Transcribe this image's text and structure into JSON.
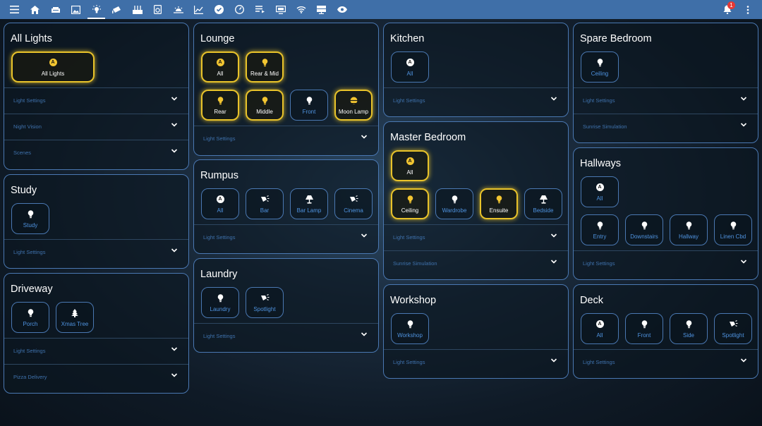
{
  "topbar": {
    "icons": [
      "menu-icon",
      "home-icon",
      "sofa-icon",
      "image-icon",
      "lightbulb-icon",
      "cctv-icon",
      "router-icon",
      "washer-icon",
      "sunrise-icon",
      "chart-icon",
      "check-circle-icon",
      "gauge-icon",
      "playlist-icon",
      "monitor-icon",
      "wifi-icon",
      "server-icon",
      "eye-icon"
    ],
    "notification_count": "1"
  },
  "cards": {
    "all_lights": {
      "title": "All Lights",
      "tiles": [
        {
          "label": "All Lights",
          "icon": "auto",
          "on": true
        }
      ],
      "rows": [
        "Light Settings",
        "Night Vision",
        "Scenes"
      ]
    },
    "study": {
      "title": "Study",
      "tiles": [
        {
          "label": "Study",
          "icon": "bulb",
          "on": false
        }
      ],
      "rows": [
        "Light Settings"
      ]
    },
    "driveway": {
      "title": "Driveway",
      "tiles": [
        {
          "label": "Porch",
          "icon": "bulb",
          "on": false
        },
        {
          "label": "Xmas Tree",
          "icon": "tree",
          "on": false
        }
      ],
      "rows": [
        "Light Settings",
        "Pizza Delivery"
      ]
    },
    "lounge": {
      "title": "Lounge",
      "tiles": [
        {
          "label": "All",
          "icon": "auto",
          "on": true
        },
        {
          "label": "Rear & Mid",
          "icon": "bulb",
          "on": true
        },
        {
          "label": "Rear",
          "icon": "bulb",
          "on": true
        },
        {
          "label": "Middle",
          "icon": "bulb",
          "on": true
        },
        {
          "label": "Front",
          "icon": "bulb",
          "on": false
        },
        {
          "label": "Moon Lamp",
          "icon": "moon",
          "on": true
        }
      ],
      "rows": [
        "Light Settings"
      ]
    },
    "rumpus": {
      "title": "Rumpus",
      "tiles": [
        {
          "label": "All",
          "icon": "auto",
          "on": false
        },
        {
          "label": "Bar",
          "icon": "spot",
          "on": false
        },
        {
          "label": "Bar Lamp",
          "icon": "lamp",
          "on": false
        },
        {
          "label": "Cinema",
          "icon": "spot",
          "on": false
        }
      ],
      "rows": [
        "Light Settings"
      ]
    },
    "laundry": {
      "title": "Laundry",
      "tiles": [
        {
          "label": "Laundry",
          "icon": "bulb",
          "on": false
        },
        {
          "label": "Spotlight",
          "icon": "spot",
          "on": false
        }
      ],
      "rows": [
        "Light Settings"
      ]
    },
    "kitchen": {
      "title": "Kitchen",
      "tiles": [
        {
          "label": "All",
          "icon": "auto",
          "on": false
        }
      ],
      "rows": [
        "Light Settings"
      ]
    },
    "master_bedroom": {
      "title": "Master Bedroom",
      "tiles": [
        {
          "label": "All",
          "icon": "auto",
          "on": true
        },
        {
          "label": "Ceiling",
          "icon": "bulb",
          "on": true
        },
        {
          "label": "Wardrobe",
          "icon": "bulb",
          "on": false
        },
        {
          "label": "Ensuite",
          "icon": "bulb",
          "on": true
        },
        {
          "label": "Bedside",
          "icon": "lamp",
          "on": false
        }
      ],
      "rows": [
        "Light Settings",
        "Sunrise Simulation"
      ]
    },
    "workshop": {
      "title": "Workshop",
      "tiles": [
        {
          "label": "Workshop",
          "icon": "bulb",
          "on": false
        }
      ],
      "rows": [
        "Light Settings"
      ]
    },
    "spare_bedroom": {
      "title": "Spare Bedroom",
      "tiles": [
        {
          "label": "Ceiling",
          "icon": "bulb",
          "on": false
        }
      ],
      "rows": [
        "Light Settings",
        "Sunrise Simulation"
      ]
    },
    "hallways": {
      "title": "Hallways",
      "tiles": [
        {
          "label": "All",
          "icon": "auto",
          "on": false
        },
        {
          "label": "Entry",
          "icon": "bulb",
          "on": false
        },
        {
          "label": "Downstairs",
          "icon": "bulb",
          "on": false
        },
        {
          "label": "Hallway",
          "icon": "bulb",
          "on": false
        },
        {
          "label": "Linen Cbd",
          "icon": "bulb",
          "on": false
        }
      ],
      "rows": [
        "Light Settings"
      ]
    },
    "deck": {
      "title": "Deck",
      "tiles": [
        {
          "label": "All",
          "icon": "auto",
          "on": false
        },
        {
          "label": "Front",
          "icon": "bulb",
          "on": false
        },
        {
          "label": "Side",
          "icon": "bulb",
          "on": false
        },
        {
          "label": "Spotlight",
          "icon": "spot",
          "on": false
        }
      ],
      "rows": [
        "Light Settings"
      ]
    }
  },
  "colors": {
    "accent": "#4a78b2",
    "on": "#e9c32a",
    "label": "#4f93e0",
    "topbar": "#3f6fa8"
  }
}
